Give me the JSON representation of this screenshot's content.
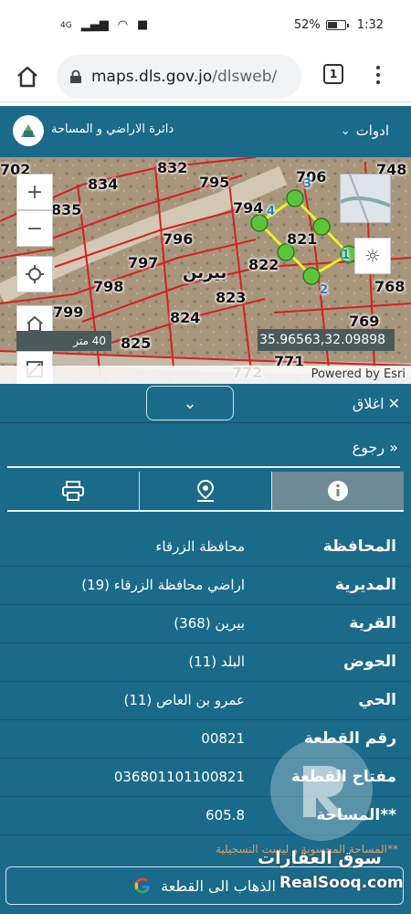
{
  "status_bar": {
    "signal_label": "4G",
    "battery_pct": "52%",
    "battery_level": 0.52,
    "time": "1:32"
  },
  "browser": {
    "url_host": "maps.dls.gov.jo",
    "url_path": "/dlsweb/",
    "tab_count": "1"
  },
  "header": {
    "org_name": "دائرة الاراضي و المساحة",
    "tools_label": "ادوات"
  },
  "map": {
    "parcels": [
      "702",
      "832",
      "706",
      "748",
      "834",
      "795",
      "835",
      "794",
      "796",
      "821",
      "797",
      "822",
      "798",
      "823",
      "799",
      "824",
      "825",
      "771",
      "772",
      "769",
      "768"
    ],
    "village_label": "بيرين",
    "scale_label": "40 متر",
    "coordinates": "35.96563,32.09898",
    "attribution": "Powered by Esri",
    "vertex_labels": [
      "1",
      "2",
      "3",
      "4"
    ]
  },
  "panel": {
    "close_label": "اغلاق",
    "back_label": "رجوع",
    "rows": [
      {
        "label": "المحافظة",
        "value": "محافظة الزرقاء"
      },
      {
        "label": "المديرية",
        "value": "اراضي محافظة الزرقاء (19)"
      },
      {
        "label": "القرية",
        "value": "بيرين (368)"
      },
      {
        "label": "الحوض",
        "value": "البلد (11)"
      },
      {
        "label": "الحي",
        "value": "عمرو بن العاص (11)"
      },
      {
        "label": "رقم القطعة",
        "value": "00821"
      },
      {
        "label": "مفتاح القطعة",
        "value": "036801101100821"
      },
      {
        "label": "**المساحة",
        "value": "605.8"
      }
    ],
    "note": "**المساحة المحسوبة و ليست التسجيلية",
    "goto_label": "الذهاب الى القطعة"
  },
  "watermark": {
    "name": "سوق العقارات",
    "url": "RealSooq.com"
  },
  "colors": {
    "primary": "#1a6a8a",
    "active_tab": "#6f8a97",
    "parcel_line": "#d62020",
    "selection": "#e8f51a",
    "vertex": "#5cc43a"
  }
}
